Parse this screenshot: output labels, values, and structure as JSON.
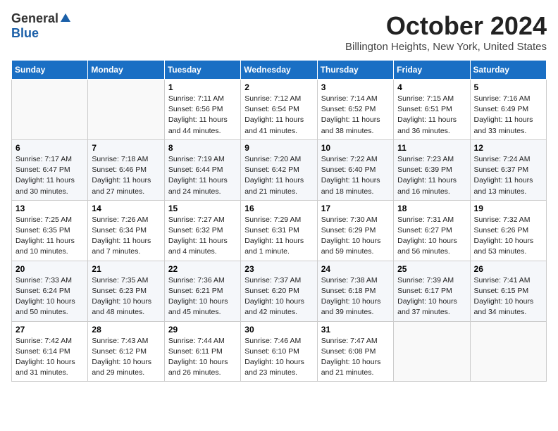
{
  "header": {
    "logo_general": "General",
    "logo_blue": "Blue",
    "month": "October 2024",
    "location": "Billington Heights, New York, United States"
  },
  "weekdays": [
    "Sunday",
    "Monday",
    "Tuesday",
    "Wednesday",
    "Thursday",
    "Friday",
    "Saturday"
  ],
  "weeks": [
    [
      {
        "day": "",
        "sunrise": "",
        "sunset": "",
        "daylight": ""
      },
      {
        "day": "",
        "sunrise": "",
        "sunset": "",
        "daylight": ""
      },
      {
        "day": "1",
        "sunrise": "Sunrise: 7:11 AM",
        "sunset": "Sunset: 6:56 PM",
        "daylight": "Daylight: 11 hours and 44 minutes."
      },
      {
        "day": "2",
        "sunrise": "Sunrise: 7:12 AM",
        "sunset": "Sunset: 6:54 PM",
        "daylight": "Daylight: 11 hours and 41 minutes."
      },
      {
        "day": "3",
        "sunrise": "Sunrise: 7:14 AM",
        "sunset": "Sunset: 6:52 PM",
        "daylight": "Daylight: 11 hours and 38 minutes."
      },
      {
        "day": "4",
        "sunrise": "Sunrise: 7:15 AM",
        "sunset": "Sunset: 6:51 PM",
        "daylight": "Daylight: 11 hours and 36 minutes."
      },
      {
        "day": "5",
        "sunrise": "Sunrise: 7:16 AM",
        "sunset": "Sunset: 6:49 PM",
        "daylight": "Daylight: 11 hours and 33 minutes."
      }
    ],
    [
      {
        "day": "6",
        "sunrise": "Sunrise: 7:17 AM",
        "sunset": "Sunset: 6:47 PM",
        "daylight": "Daylight: 11 hours and 30 minutes."
      },
      {
        "day": "7",
        "sunrise": "Sunrise: 7:18 AM",
        "sunset": "Sunset: 6:46 PM",
        "daylight": "Daylight: 11 hours and 27 minutes."
      },
      {
        "day": "8",
        "sunrise": "Sunrise: 7:19 AM",
        "sunset": "Sunset: 6:44 PM",
        "daylight": "Daylight: 11 hours and 24 minutes."
      },
      {
        "day": "9",
        "sunrise": "Sunrise: 7:20 AM",
        "sunset": "Sunset: 6:42 PM",
        "daylight": "Daylight: 11 hours and 21 minutes."
      },
      {
        "day": "10",
        "sunrise": "Sunrise: 7:22 AM",
        "sunset": "Sunset: 6:40 PM",
        "daylight": "Daylight: 11 hours and 18 minutes."
      },
      {
        "day": "11",
        "sunrise": "Sunrise: 7:23 AM",
        "sunset": "Sunset: 6:39 PM",
        "daylight": "Daylight: 11 hours and 16 minutes."
      },
      {
        "day": "12",
        "sunrise": "Sunrise: 7:24 AM",
        "sunset": "Sunset: 6:37 PM",
        "daylight": "Daylight: 11 hours and 13 minutes."
      }
    ],
    [
      {
        "day": "13",
        "sunrise": "Sunrise: 7:25 AM",
        "sunset": "Sunset: 6:35 PM",
        "daylight": "Daylight: 11 hours and 10 minutes."
      },
      {
        "day": "14",
        "sunrise": "Sunrise: 7:26 AM",
        "sunset": "Sunset: 6:34 PM",
        "daylight": "Daylight: 11 hours and 7 minutes."
      },
      {
        "day": "15",
        "sunrise": "Sunrise: 7:27 AM",
        "sunset": "Sunset: 6:32 PM",
        "daylight": "Daylight: 11 hours and 4 minutes."
      },
      {
        "day": "16",
        "sunrise": "Sunrise: 7:29 AM",
        "sunset": "Sunset: 6:31 PM",
        "daylight": "Daylight: 11 hours and 1 minute."
      },
      {
        "day": "17",
        "sunrise": "Sunrise: 7:30 AM",
        "sunset": "Sunset: 6:29 PM",
        "daylight": "Daylight: 10 hours and 59 minutes."
      },
      {
        "day": "18",
        "sunrise": "Sunrise: 7:31 AM",
        "sunset": "Sunset: 6:27 PM",
        "daylight": "Daylight: 10 hours and 56 minutes."
      },
      {
        "day": "19",
        "sunrise": "Sunrise: 7:32 AM",
        "sunset": "Sunset: 6:26 PM",
        "daylight": "Daylight: 10 hours and 53 minutes."
      }
    ],
    [
      {
        "day": "20",
        "sunrise": "Sunrise: 7:33 AM",
        "sunset": "Sunset: 6:24 PM",
        "daylight": "Daylight: 10 hours and 50 minutes."
      },
      {
        "day": "21",
        "sunrise": "Sunrise: 7:35 AM",
        "sunset": "Sunset: 6:23 PM",
        "daylight": "Daylight: 10 hours and 48 minutes."
      },
      {
        "day": "22",
        "sunrise": "Sunrise: 7:36 AM",
        "sunset": "Sunset: 6:21 PM",
        "daylight": "Daylight: 10 hours and 45 minutes."
      },
      {
        "day": "23",
        "sunrise": "Sunrise: 7:37 AM",
        "sunset": "Sunset: 6:20 PM",
        "daylight": "Daylight: 10 hours and 42 minutes."
      },
      {
        "day": "24",
        "sunrise": "Sunrise: 7:38 AM",
        "sunset": "Sunset: 6:18 PM",
        "daylight": "Daylight: 10 hours and 39 minutes."
      },
      {
        "day": "25",
        "sunrise": "Sunrise: 7:39 AM",
        "sunset": "Sunset: 6:17 PM",
        "daylight": "Daylight: 10 hours and 37 minutes."
      },
      {
        "day": "26",
        "sunrise": "Sunrise: 7:41 AM",
        "sunset": "Sunset: 6:15 PM",
        "daylight": "Daylight: 10 hours and 34 minutes."
      }
    ],
    [
      {
        "day": "27",
        "sunrise": "Sunrise: 7:42 AM",
        "sunset": "Sunset: 6:14 PM",
        "daylight": "Daylight: 10 hours and 31 minutes."
      },
      {
        "day": "28",
        "sunrise": "Sunrise: 7:43 AM",
        "sunset": "Sunset: 6:12 PM",
        "daylight": "Daylight: 10 hours and 29 minutes."
      },
      {
        "day": "29",
        "sunrise": "Sunrise: 7:44 AM",
        "sunset": "Sunset: 6:11 PM",
        "daylight": "Daylight: 10 hours and 26 minutes."
      },
      {
        "day": "30",
        "sunrise": "Sunrise: 7:46 AM",
        "sunset": "Sunset: 6:10 PM",
        "daylight": "Daylight: 10 hours and 23 minutes."
      },
      {
        "day": "31",
        "sunrise": "Sunrise: 7:47 AM",
        "sunset": "Sunset: 6:08 PM",
        "daylight": "Daylight: 10 hours and 21 minutes."
      },
      {
        "day": "",
        "sunrise": "",
        "sunset": "",
        "daylight": ""
      },
      {
        "day": "",
        "sunrise": "",
        "sunset": "",
        "daylight": ""
      }
    ]
  ]
}
